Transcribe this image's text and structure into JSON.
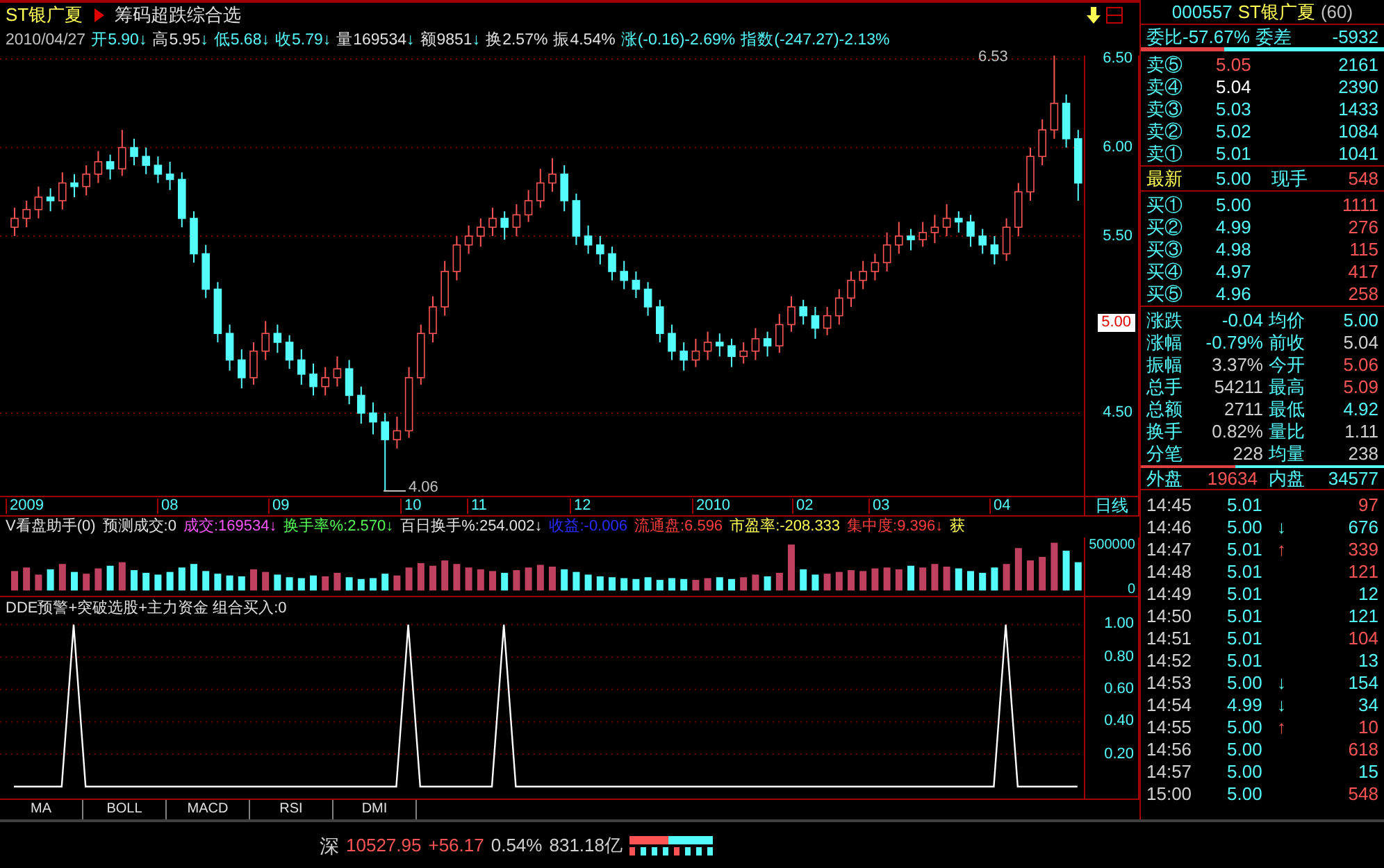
{
  "header": {
    "stock_name": "ST银广夏",
    "formula_name": "筹码超跌综合选"
  },
  "quote_line": [
    {
      "text": "2010/04/27",
      "color": "#c0c0c0"
    },
    {
      "text": "开5.90",
      "color": "#54fcfc",
      "arrow": "↓"
    },
    {
      "text": "高5.95",
      "color": "#e0e0e0",
      "arrow": "↓"
    },
    {
      "text": "低5.68",
      "color": "#54fcfc",
      "arrow": "↓"
    },
    {
      "text": "收5.79",
      "color": "#54fcfc",
      "arrow": "↓"
    },
    {
      "text": "量169534",
      "color": "#e0e0e0",
      "arrow": "↓"
    },
    {
      "text": "额9851",
      "color": "#e0e0e0",
      "arrow": "↓"
    },
    {
      "text": "换2.57%",
      "color": "#e0e0e0"
    },
    {
      "text": "振4.54%",
      "color": "#e0e0e0"
    },
    {
      "text": "涨(-0.16)-2.69%",
      "color": "#54fcfc"
    },
    {
      "text": "指数(-247.27)-2.13%",
      "color": "#54fcfc"
    }
  ],
  "price_chart": {
    "high_label": "6.53",
    "low_label": "4.06",
    "current_price": "5.00",
    "period": "日线",
    "date_axis": [
      "2009",
      "08",
      "09",
      "10",
      "11",
      "12",
      "2010",
      "02",
      "03",
      "04"
    ],
    "chart_data": {
      "type": "candlestick",
      "grid": true,
      "categories": [
        null,
        null,
        null,
        null,
        null,
        null,
        null,
        null,
        null,
        null,
        null,
        null,
        null,
        null,
        null,
        null,
        null,
        null,
        null,
        null,
        null,
        null,
        null,
        null,
        null,
        null,
        null,
        null,
        null,
        null,
        null,
        null,
        null,
        null,
        null,
        null,
        null,
        null,
        null,
        null,
        null,
        null,
        null,
        null,
        null,
        null,
        null,
        null,
        null,
        null,
        null,
        null,
        null,
        null,
        null,
        null,
        null,
        null,
        null,
        null,
        null,
        null,
        null,
        null,
        null,
        null,
        null,
        null,
        null,
        null,
        null,
        null,
        null,
        null,
        null,
        null,
        null,
        null,
        null,
        null,
        null,
        null,
        null,
        null,
        null,
        null,
        null,
        null,
        null,
        null
      ],
      "ohlc": [
        [
          5.55,
          5.66,
          5.5,
          5.6
        ],
        [
          5.6,
          5.7,
          5.55,
          5.65
        ],
        [
          5.65,
          5.78,
          5.6,
          5.72
        ],
        [
          5.72,
          5.77,
          5.64,
          5.7
        ],
        [
          5.7,
          5.86,
          5.65,
          5.8
        ],
        [
          5.8,
          5.85,
          5.72,
          5.78
        ],
        [
          5.78,
          5.9,
          5.73,
          5.85
        ],
        [
          5.85,
          5.98,
          5.8,
          5.92
        ],
        [
          5.92,
          5.96,
          5.82,
          5.88
        ],
        [
          5.88,
          6.1,
          5.84,
          6.0
        ],
        [
          6.0,
          6.05,
          5.9,
          5.95
        ],
        [
          5.95,
          6.0,
          5.85,
          5.9
        ],
        [
          5.9,
          5.95,
          5.8,
          5.85
        ],
        [
          5.85,
          5.92,
          5.76,
          5.82
        ],
        [
          5.82,
          5.86,
          5.55,
          5.6
        ],
        [
          5.6,
          5.64,
          5.35,
          5.4
        ],
        [
          5.4,
          5.45,
          5.15,
          5.2
        ],
        [
          5.2,
          5.24,
          4.9,
          4.95
        ],
        [
          4.95,
          5.0,
          4.74,
          4.8
        ],
        [
          4.8,
          4.86,
          4.64,
          4.7
        ],
        [
          4.7,
          4.9,
          4.66,
          4.85
        ],
        [
          4.85,
          5.02,
          4.8,
          4.95
        ],
        [
          4.95,
          5.0,
          4.84,
          4.9
        ],
        [
          4.9,
          4.94,
          4.75,
          4.8
        ],
        [
          4.8,
          4.86,
          4.66,
          4.72
        ],
        [
          4.72,
          4.78,
          4.6,
          4.65
        ],
        [
          4.65,
          4.76,
          4.6,
          4.7
        ],
        [
          4.7,
          4.82,
          4.65,
          4.75
        ],
        [
          4.75,
          4.8,
          4.55,
          4.6
        ],
        [
          4.6,
          4.65,
          4.44,
          4.5
        ],
        [
          4.5,
          4.56,
          4.38,
          4.45
        ],
        [
          4.45,
          4.5,
          4.06,
          4.35
        ],
        [
          4.35,
          4.48,
          4.3,
          4.4
        ],
        [
          4.4,
          4.76,
          4.36,
          4.7
        ],
        [
          4.7,
          5.0,
          4.66,
          4.95
        ],
        [
          4.95,
          5.16,
          4.9,
          5.1
        ],
        [
          5.1,
          5.36,
          5.05,
          5.3
        ],
        [
          5.3,
          5.5,
          5.25,
          5.45
        ],
        [
          5.45,
          5.56,
          5.4,
          5.5
        ],
        [
          5.5,
          5.6,
          5.44,
          5.55
        ],
        [
          5.55,
          5.66,
          5.5,
          5.6
        ],
        [
          5.6,
          5.64,
          5.48,
          5.55
        ],
        [
          5.55,
          5.68,
          5.5,
          5.62
        ],
        [
          5.62,
          5.76,
          5.58,
          5.7
        ],
        [
          5.7,
          5.88,
          5.66,
          5.8
        ],
        [
          5.8,
          5.94,
          5.75,
          5.85
        ],
        [
          5.85,
          5.9,
          5.64,
          5.7
        ],
        [
          5.7,
          5.74,
          5.45,
          5.5
        ],
        [
          5.5,
          5.56,
          5.4,
          5.45
        ],
        [
          5.45,
          5.5,
          5.34,
          5.4
        ],
        [
          5.4,
          5.44,
          5.25,
          5.3
        ],
        [
          5.3,
          5.36,
          5.2,
          5.25
        ],
        [
          5.25,
          5.3,
          5.15,
          5.2
        ],
        [
          5.2,
          5.24,
          5.05,
          5.1
        ],
        [
          5.1,
          5.14,
          4.9,
          4.95
        ],
        [
          4.95,
          5.0,
          4.8,
          4.85
        ],
        [
          4.85,
          4.9,
          4.74,
          4.8
        ],
        [
          4.8,
          4.92,
          4.76,
          4.85
        ],
        [
          4.85,
          4.96,
          4.8,
          4.9
        ],
        [
          4.9,
          4.95,
          4.82,
          4.88
        ],
        [
          4.88,
          4.92,
          4.76,
          4.82
        ],
        [
          4.82,
          4.9,
          4.78,
          4.85
        ],
        [
          4.85,
          4.98,
          4.8,
          4.92
        ],
        [
          4.92,
          4.96,
          4.82,
          4.88
        ],
        [
          4.88,
          5.06,
          4.84,
          5.0
        ],
        [
          5.0,
          5.16,
          4.96,
          5.1
        ],
        [
          5.1,
          5.14,
          5.0,
          5.05
        ],
        [
          5.05,
          5.1,
          4.92,
          4.98
        ],
        [
          4.98,
          5.1,
          4.94,
          5.05
        ],
        [
          5.05,
          5.2,
          5.0,
          5.15
        ],
        [
          5.15,
          5.3,
          5.1,
          5.25
        ],
        [
          5.25,
          5.36,
          5.2,
          5.3
        ],
        [
          5.3,
          5.4,
          5.25,
          5.35
        ],
        [
          5.35,
          5.52,
          5.3,
          5.45
        ],
        [
          5.45,
          5.58,
          5.4,
          5.5
        ],
        [
          5.5,
          5.54,
          5.42,
          5.48
        ],
        [
          5.48,
          5.58,
          5.44,
          5.52
        ],
        [
          5.52,
          5.62,
          5.46,
          5.55
        ],
        [
          5.55,
          5.68,
          5.5,
          5.6
        ],
        [
          5.6,
          5.64,
          5.52,
          5.58
        ],
        [
          5.58,
          5.62,
          5.44,
          5.5
        ],
        [
          5.5,
          5.54,
          5.4,
          5.45
        ],
        [
          5.45,
          5.5,
          5.34,
          5.4
        ],
        [
          5.4,
          5.6,
          5.36,
          5.55
        ],
        [
          5.55,
          5.8,
          5.5,
          5.75
        ],
        [
          5.75,
          6.0,
          5.7,
          5.95
        ],
        [
          5.95,
          6.16,
          5.9,
          6.1
        ],
        [
          6.1,
          6.53,
          6.05,
          6.25
        ],
        [
          6.25,
          6.3,
          6.0,
          6.05
        ],
        [
          6.05,
          6.1,
          5.7,
          5.8
        ]
      ],
      "ylim": [
        3.915,
        6.52
      ],
      "yticks": [
        {
          "value": 6.5,
          "label": "6.50"
        },
        {
          "value": 6.0,
          "label": "6.00"
        },
        {
          "value": 5.5,
          "label": "5.50"
        },
        {
          "value": 4.5,
          "label": "4.50"
        }
      ]
    }
  },
  "volume_panel": {
    "items": [
      {
        "text": "V看盘助手(0)",
        "color": "#e0e0e0"
      },
      {
        "text": "预测成交:0",
        "color": "#e0e0e0"
      },
      {
        "text": "成交:169534",
        "color": "#fc54fc",
        "arrow": "↓"
      },
      {
        "text": "换手率%:2.570",
        "color": "#54fc54",
        "arrow": "↓"
      },
      {
        "text": "百日换手%:254.002",
        "color": "#e0e0e0",
        "arrow": "↓"
      },
      {
        "text": "收益:-0.006",
        "color": "#2a2afc"
      },
      {
        "text": "流通盘:6.596",
        "color": "#fc3c3c"
      },
      {
        "text": "市盈率:-208.333",
        "color": "#fcfc54"
      },
      {
        "text": "集中度:9.396",
        "color": "#fc3c3c",
        "arrow": "↓"
      },
      {
        "text": "获",
        "color": "#fcfc54"
      }
    ],
    "chart_data": {
      "type": "bar",
      "ylim": [
        -60000,
        600000
      ],
      "categories": [
        null,
        null,
        null,
        null,
        null,
        null,
        null,
        null,
        null,
        null,
        null,
        null,
        null,
        null,
        null,
        null,
        null,
        null,
        null,
        null,
        null,
        null,
        null,
        null,
        null,
        null,
        null,
        null,
        null,
        null,
        null,
        null,
        null,
        null,
        null,
        null,
        null,
        null,
        null,
        null,
        null,
        null,
        null,
        null,
        null,
        null,
        null,
        null,
        null,
        null,
        null,
        null,
        null,
        null,
        null,
        null,
        null,
        null,
        null,
        null,
        null,
        null,
        null,
        null,
        null,
        null,
        null,
        null,
        null,
        null,
        null,
        null,
        null,
        null,
        null,
        null,
        null,
        null,
        null,
        null,
        null,
        null,
        null,
        null,
        null,
        null,
        null,
        null,
        null,
        null
      ],
      "yticks": [
        {
          "value": 500000,
          "label": "500000"
        },
        {
          "value": 0,
          "label": "0"
        }
      ],
      "series": [
        {
          "color": "#c04060",
          "values": [
            220000,
            260000,
            180000,
            null,
            300000,
            null,
            190000,
            250000,
            null,
            320000,
            null,
            null,
            null,
            null,
            null,
            null,
            null,
            null,
            null,
            null,
            240000,
            210000,
            null,
            null,
            null,
            null,
            160000,
            200000,
            null,
            null,
            null,
            null,
            170000,
            260000,
            310000,
            280000,
            340000,
            300000,
            260000,
            240000,
            220000,
            null,
            230000,
            260000,
            290000,
            270000,
            null,
            null,
            null,
            null,
            null,
            null,
            null,
            null,
            null,
            null,
            null,
            120000,
            140000,
            null,
            null,
            150000,
            180000,
            null,
            200000,
            520000,
            null,
            null,
            190000,
            210000,
            230000,
            220000,
            250000,
            260000,
            240000,
            null,
            260000,
            300000,
            270000,
            null,
            null,
            null,
            null,
            300000,
            480000,
            340000,
            380000,
            540000,
            null,
            null
          ]
        },
        {
          "color": "#54fcfc",
          "values": [
            null,
            null,
            null,
            240000,
            null,
            210000,
            null,
            null,
            280000,
            null,
            230000,
            200000,
            180000,
            210000,
            260000,
            300000,
            220000,
            190000,
            170000,
            160000,
            null,
            null,
            180000,
            150000,
            140000,
            170000,
            null,
            null,
            150000,
            130000,
            140000,
            190000,
            null,
            null,
            null,
            null,
            null,
            null,
            null,
            null,
            null,
            200000,
            null,
            null,
            null,
            null,
            240000,
            210000,
            180000,
            160000,
            150000,
            140000,
            130000,
            150000,
            120000,
            140000,
            130000,
            null,
            null,
            150000,
            130000,
            null,
            null,
            160000,
            null,
            null,
            240000,
            180000,
            null,
            null,
            null,
            null,
            null,
            null,
            null,
            280000,
            null,
            null,
            null,
            250000,
            220000,
            200000,
            260000,
            null,
            null,
            null,
            null,
            null,
            450000,
            320000
          ]
        }
      ]
    }
  },
  "indicator_panel": {
    "title": "DDE预警+突破选股+主力资金 组合买入:0",
    "chart_data": {
      "type": "line",
      "ylim": [
        -0.1,
        1.17
      ],
      "grid": true,
      "yticks": [
        {
          "value": 1,
          "label": "1.00"
        },
        {
          "value": 0.8,
          "label": "0.80"
        },
        {
          "value": 0.6,
          "label": "0.60"
        },
        {
          "value": 0.4,
          "label": "0.40"
        },
        {
          "value": 0.2,
          "label": "0.20"
        }
      ],
      "values": [
        0,
        0,
        0,
        0,
        0,
        1,
        0,
        0,
        0,
        0,
        0,
        0,
        0,
        0,
        0,
        0,
        0,
        0,
        0,
        0,
        0,
        0,
        0,
        0,
        0,
        0,
        0,
        0,
        0,
        0,
        0,
        0,
        0,
        1,
        0,
        0,
        0,
        0,
        0,
        0,
        0,
        1,
        0,
        0,
        0,
        0,
        0,
        0,
        0,
        0,
        0,
        0,
        0,
        0,
        0,
        0,
        0,
        0,
        0,
        0,
        0,
        0,
        0,
        0,
        0,
        0,
        0,
        0,
        0,
        0,
        0,
        0,
        0,
        0,
        0,
        0,
        0,
        0,
        0,
        0,
        0,
        0,
        0,
        1,
        0,
        0,
        0,
        0,
        0,
        0
      ]
    }
  },
  "tabs": [
    {
      "label": "MA"
    },
    {
      "label": "BOLL"
    },
    {
      "label": "MACD"
    },
    {
      "label": "RSI"
    },
    {
      "label": "DMI"
    }
  ],
  "quote_panel": {
    "code": "000557",
    "name": "ST银广夏",
    "period": "(60)",
    "ratio_label": "委比",
    "ratio": "-57.67%",
    "diff_label": "委差",
    "diff": "-5932",
    "asks": [
      {
        "label": "卖⑤",
        "price": "5.05",
        "color": "#fc5454",
        "volume": "2161"
      },
      {
        "label": "卖④",
        "price": "5.04",
        "color": "#ffffff",
        "volume": "2390"
      },
      {
        "label": "卖③",
        "price": "5.03",
        "color": "#54fcfc",
        "volume": "1433"
      },
      {
        "label": "卖②",
        "price": "5.02",
        "color": "#54fcfc",
        "volume": "1084"
      },
      {
        "label": "卖①",
        "price": "5.01",
        "color": "#54fcfc",
        "volume": "1041"
      }
    ],
    "last": {
      "label": "最新",
      "price": "5.00",
      "label2": "现手",
      "volume": "548"
    },
    "bids": [
      {
        "label": "买①",
        "price": "5.00",
        "color": "#54fcfc",
        "volume": "1111"
      },
      {
        "label": "买②",
        "price": "4.99",
        "color": "#54fcfc",
        "volume": "276"
      },
      {
        "label": "买③",
        "price": "4.98",
        "color": "#54fcfc",
        "volume": "115"
      },
      {
        "label": "买④",
        "price": "4.97",
        "color": "#54fcfc",
        "volume": "417"
      },
      {
        "label": "买⑤",
        "price": "4.96",
        "color": "#54fcfc",
        "volume": "258"
      }
    ],
    "stats": [
      {
        "label": "涨跌",
        "value": "-0.04",
        "color": "#54fcfc"
      },
      {
        "label": "均价",
        "value": "5.00",
        "color": "#54fcfc"
      },
      {
        "label": "涨幅",
        "value": "-0.79%",
        "color": "#54fcfc"
      },
      {
        "label": "前收",
        "value": "5.04",
        "color": "#d0d0d0"
      },
      {
        "label": "振幅",
        "value": "3.37%",
        "color": "#d0d0d0"
      },
      {
        "label": "今开",
        "value": "5.06",
        "color": "#fc5454"
      },
      {
        "label": "总手",
        "value": "54211",
        "color": "#d0d0d0"
      },
      {
        "label": "最高",
        "value": "5.09",
        "color": "#fc5454"
      },
      {
        "label": "总额",
        "value": "2711",
        "color": "#d0d0d0"
      },
      {
        "label": "最低",
        "value": "4.92",
        "color": "#54fcfc"
      },
      {
        "label": "换手",
        "value": "0.82%",
        "color": "#d0d0d0"
      },
      {
        "label": "量比",
        "value": "1.11",
        "color": "#d0d0d0"
      },
      {
        "label": "分笔",
        "value": "228",
        "color": "#d0d0d0"
      },
      {
        "label": "均量",
        "value": "238",
        "color": "#d0d0d0"
      }
    ],
    "outer": {
      "label": "外盘",
      "value": "19634",
      "label2": "内盘",
      "value2": "34577"
    },
    "ticks": [
      {
        "time": "14:45",
        "price": "5.01",
        "volume": "97",
        "color": "#fc5454"
      },
      {
        "time": "14:46",
        "price": "5.00",
        "arrow": {
          "text": "↓",
          "color": "#54fcfc"
        },
        "volume": "676",
        "color": "#54fcfc"
      },
      {
        "time": "14:47",
        "price": "5.01",
        "arrow": {
          "text": "↑",
          "color": "#fc5454"
        },
        "volume": "339",
        "color": "#fc5454"
      },
      {
        "time": "14:48",
        "price": "5.01",
        "volume": "121",
        "color": "#fc5454"
      },
      {
        "time": "14:49",
        "price": "5.01",
        "volume": "12",
        "color": "#54fcfc"
      },
      {
        "time": "14:50",
        "price": "5.01",
        "volume": "121",
        "color": "#54fcfc"
      },
      {
        "time": "14:51",
        "price": "5.01",
        "volume": "104",
        "color": "#fc5454"
      },
      {
        "time": "14:52",
        "price": "5.01",
        "volume": "13",
        "color": "#54fcfc"
      },
      {
        "time": "14:53",
        "price": "5.00",
        "arrow": {
          "text": "↓",
          "color": "#54fcfc"
        },
        "volume": "154",
        "color": "#54fcfc"
      },
      {
        "time": "14:54",
        "price": "4.99",
        "arrow": {
          "text": "↓",
          "color": "#54fcfc"
        },
        "volume": "34",
        "color": "#54fcfc"
      },
      {
        "time": "14:55",
        "price": "5.00",
        "arrow": {
          "text": "↑",
          "color": "#fc5454"
        },
        "volume": "10",
        "color": "#fc5454"
      },
      {
        "time": "14:56",
        "price": "5.00",
        "volume": "618",
        "color": "#fc5454"
      },
      {
        "time": "14:57",
        "price": "5.00",
        "volume": "15",
        "color": "#54fcfc"
      },
      {
        "time": "15:00",
        "price": "5.00",
        "volume": "548",
        "color": "#fc5454"
      }
    ]
  },
  "status_bar": {
    "market": "深",
    "index": "10527.95",
    "change": "+56.17",
    "percent": "0.54%",
    "amount": "831.18亿"
  }
}
